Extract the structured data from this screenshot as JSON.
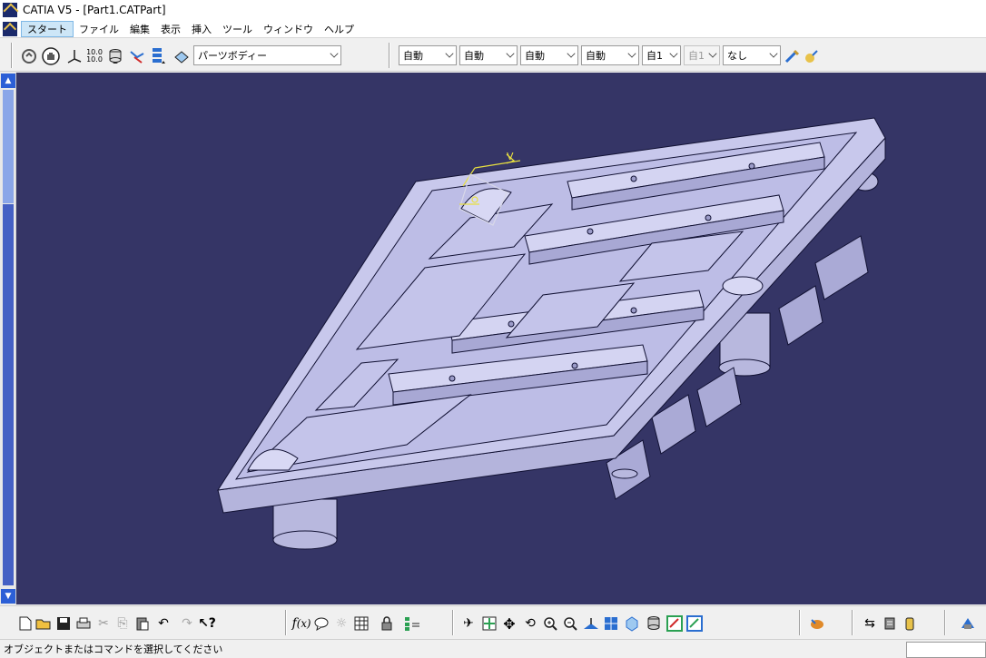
{
  "window": {
    "title": "CATIA V5 - [Part1.CATPart]"
  },
  "menu": {
    "items": [
      "スタート",
      "ファイル",
      "編集",
      "表示",
      "挿入",
      "ツール",
      "ウィンドウ",
      "ヘルプ"
    ]
  },
  "toolbar_top": {
    "body_select": "パーツボディー",
    "combos": [
      {
        "value": "自動",
        "enabled": true
      },
      {
        "value": "自動",
        "enabled": true
      },
      {
        "value": "自動",
        "enabled": true
      },
      {
        "value": "自動",
        "enabled": true
      },
      {
        "value": "自1",
        "enabled": true
      },
      {
        "value": "自1",
        "enabled": false
      },
      {
        "value": "なし",
        "enabled": true
      }
    ],
    "icons": [
      "rotate-icon",
      "hand-icon",
      "axis-icon",
      "number-icon",
      "cylinder-icon",
      "snap-icon",
      "layer-icon",
      "body-icon",
      "brush-icon",
      "paint-icon"
    ]
  },
  "toolbar_bottom": {
    "icons": [
      "new-icon",
      "open-icon",
      "save-icon",
      "print-icon",
      "cut-icon",
      "copy-icon",
      "paste-icon",
      "undo-icon",
      "redo-icon",
      "whatsthis-icon",
      "formula-icon",
      "comment-icon",
      "bulb-icon",
      "table-icon",
      "lock-icon",
      "tree-icon",
      "fly-icon",
      "fit-icon",
      "pan-icon",
      "rotate-view-icon",
      "zoom-in-icon",
      "zoom-out-icon",
      "normal-view-icon",
      "views-icon",
      "iso-icon",
      "hide-icon",
      "swap-icon",
      "measure-icon",
      "update-icon",
      "balloon-icon",
      "teapot-icon",
      "swap-space-icon",
      "material-icon",
      "workbench-icon"
    ]
  },
  "status": {
    "message": "オブジェクトまたはコマンドを選択してください"
  },
  "colors": {
    "viewport_bg": "#353566",
    "part_fill": "#c8c8ec",
    "part_edge": "#111133"
  }
}
